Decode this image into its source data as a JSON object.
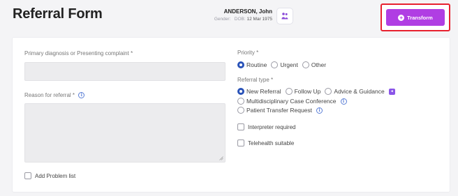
{
  "page_title": "Referral Form",
  "patient": {
    "name": "ANDERSON, John",
    "gender_label": "Gender:",
    "dob_label": "DOB:",
    "dob_value": "12 Mar 1975"
  },
  "transform_button": {
    "label": "Transform",
    "icon": "plus-circle-icon"
  },
  "form": {
    "primary_diagnosis_label": "Primary diagnosis or Presenting complaint *",
    "reason_label": "Reason for referral *",
    "add_problem_list_label": "Add Problem list",
    "priority": {
      "label": "Priority *",
      "options": [
        "Routine",
        "Urgent",
        "Other"
      ],
      "selected": "Routine"
    },
    "referral_type": {
      "label": "Referral type *",
      "options": [
        "New Referral",
        "Follow Up",
        "Advice & Guidance",
        "Multidisciplinary Case Conference",
        "Patient Transfer Request"
      ],
      "selected": "New Referral"
    },
    "interpreter_label": "Interpreter required",
    "telehealth_label": "Telehealth suitable"
  },
  "colors": {
    "accent": "#b03ee3",
    "radio_selected": "#2952b8",
    "highlight_border": "#e8212f"
  }
}
